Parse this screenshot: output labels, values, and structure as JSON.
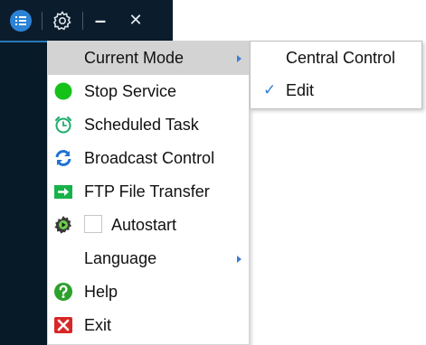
{
  "menu": {
    "items": [
      {
        "label": "Current Mode"
      },
      {
        "label": "Stop Service"
      },
      {
        "label": "Scheduled Task"
      },
      {
        "label": "Broadcast Control"
      },
      {
        "label": "FTP File Transfer"
      },
      {
        "label": "Autostart",
        "checked": false
      },
      {
        "label": "Language"
      },
      {
        "label": "Help"
      },
      {
        "label": "Exit"
      }
    ]
  },
  "submenu": {
    "items": [
      {
        "label": "Central Control"
      },
      {
        "label": "Edit",
        "checked": true,
        "check_glyph": "✓"
      }
    ]
  },
  "toolbar": {
    "minimize_glyph": "–",
    "close_glyph": "✕"
  },
  "colors": {
    "accent": "#2f7fd8",
    "toolbar_bg": "#0b1d2c",
    "menu_highlight": "#d3d3d3",
    "stop_green": "#16c21a",
    "exit_red": "#d92626",
    "help_green": "#2ca02c"
  },
  "icons": {
    "list": "list-icon",
    "settings": "gear-icon",
    "stop": "green-circle-icon",
    "schedule": "alarm-clock-icon",
    "broadcast": "refresh-arrows-icon",
    "ftp": "file-transfer-icon",
    "autostart": "play-gear-icon",
    "help": "help-icon",
    "exit": "exit-icon"
  }
}
